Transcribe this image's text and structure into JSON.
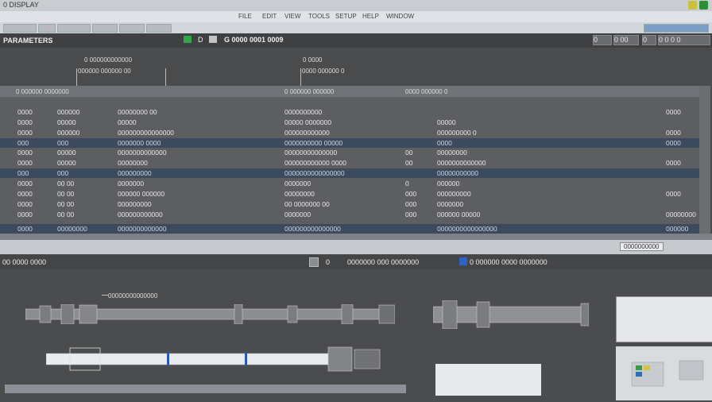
{
  "titlebar": {
    "label": "0 DISPLAY",
    "colors": [
      "#c8c23a",
      "#2c8f3a"
    ]
  },
  "menu": {
    "items": [
      "FILE",
      "EDIT",
      "VIEW",
      "TOOLS",
      "SETUP",
      "HELP",
      "WINDOW"
    ],
    "search_value": ""
  },
  "panel": {
    "title": "PARAMETERS",
    "center_label": "G 0000 0001 0009",
    "right_buttons": [
      "0",
      "0 00",
      "0",
      "0 0 0 0"
    ]
  },
  "callouts": [
    {
      "text": "0 000000000000"
    },
    {
      "text": "000000 000000 00"
    },
    {
      "text": "0 0000"
    },
    {
      "text": "0000 000000 0"
    }
  ],
  "table": {
    "header": [
      "0 000000 0000000",
      "0 000000 000000",
      "0000 000000 0"
    ],
    "rows": [
      {
        "cells": [
          "0000",
          "000000",
          "00000000 00",
          "0000000000",
          "",
          "",
          "0000"
        ],
        "style": "normal"
      },
      {
        "cells": [
          "0000",
          "00000",
          "00000",
          "00000 0000000",
          "",
          "00000",
          ""
        ],
        "style": "normal"
      },
      {
        "cells": [
          "0000",
          "000000",
          "000000000000000",
          "000000000000",
          "",
          "000000000 0",
          "0000"
        ],
        "style": "normal"
      },
      {
        "cells": [
          "000",
          "000",
          "0000000 0000",
          "0000000000 00000",
          "",
          "0000",
          "0000"
        ],
        "style": "band"
      },
      {
        "cells": [
          "0000",
          "00000",
          "0000000000000",
          "00000000000000",
          "00",
          "00000000",
          ""
        ],
        "style": "normal"
      },
      {
        "cells": [
          "0000",
          "00000",
          "00000000",
          "000000000000 0000",
          "00",
          "0000000000000",
          "0000"
        ],
        "style": "normal"
      },
      {
        "cells": [
          "000",
          "000",
          "000000000",
          "0000000000000000",
          "",
          "00000000000",
          ""
        ],
        "style": "band"
      },
      {
        "cells": [
          "0000",
          "00 00",
          "0000000",
          "0000000",
          "0",
          "000000",
          ""
        ],
        "style": "normal"
      },
      {
        "cells": [
          "0000",
          "00 00",
          "000000 000000",
          "00000000",
          "000",
          "000000000",
          "0000"
        ],
        "style": "normal"
      },
      {
        "cells": [
          "0000",
          "00 00",
          "000000000",
          "00 0000000 00",
          "000",
          "0000000",
          ""
        ],
        "style": "normal"
      },
      {
        "cells": [
          "0000",
          "00 00",
          "000000000000",
          "0000000",
          "000",
          "000000 00000",
          "00000000"
        ],
        "style": "normal"
      },
      {
        "cells": [
          "0000",
          "00000000",
          "0000000000000",
          "000000000000000",
          "",
          "0000000000000000",
          "000000"
        ],
        "style": "band"
      }
    ]
  },
  "status": {
    "right": "0000000000"
  },
  "lower": {
    "title": "00 0000 0000",
    "items": [
      "0",
      "0",
      "0000000 000 0000000",
      "0 000000 0000 0000000"
    ]
  },
  "canvas": {
    "label": "00000000000000"
  }
}
